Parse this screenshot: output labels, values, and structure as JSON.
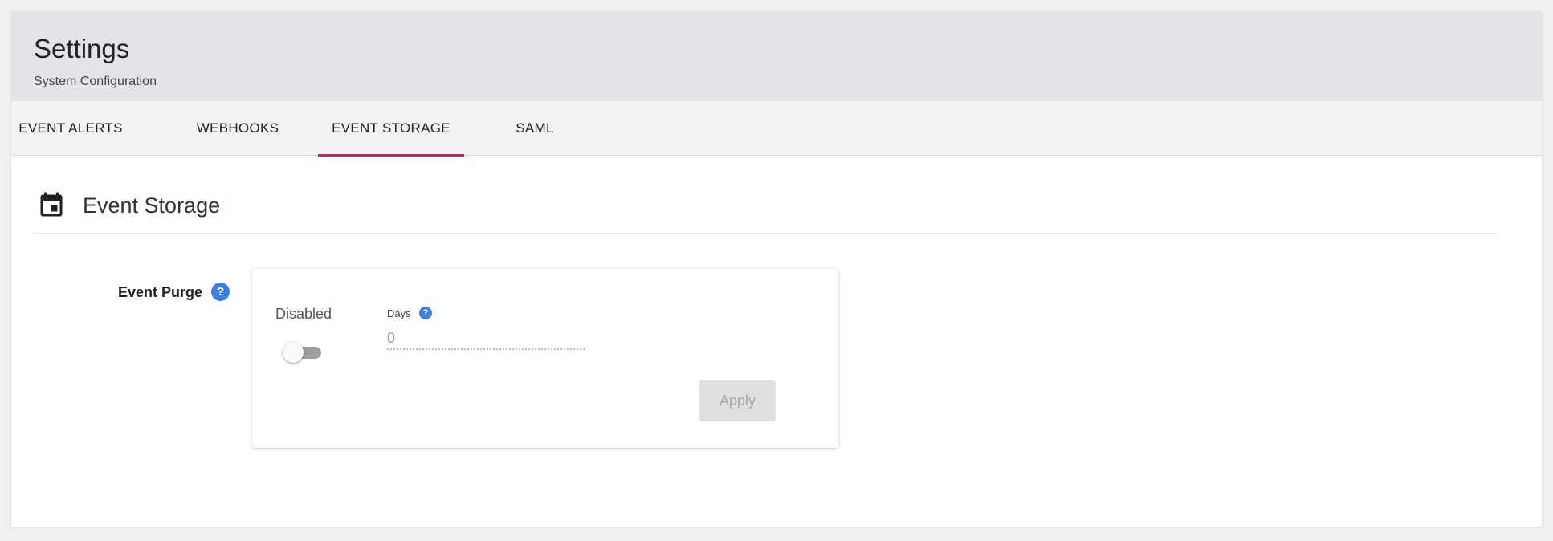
{
  "header": {
    "title": "Settings",
    "subtitle": "System Configuration"
  },
  "tabs": [
    {
      "label": "EVENT ALERTS",
      "active": false
    },
    {
      "label": "WEBHOOKS",
      "active": false
    },
    {
      "label": "EVENT STORAGE",
      "active": true
    },
    {
      "label": "SAML",
      "active": false
    }
  ],
  "section": {
    "title": "Event Storage",
    "icon": "calendar-icon"
  },
  "event_purge": {
    "label": "Event Purge",
    "help_glyph": "?",
    "toggle_label": "Disabled",
    "toggle_on": false,
    "days_label": "Days",
    "days_value": "0",
    "apply_label": "Apply",
    "apply_disabled": true
  },
  "colors": {
    "accent": "#a8325e",
    "help": "#3d7fe0",
    "header_bg": "#e4e4e8",
    "tabbar_bg": "#f2f2f4"
  }
}
